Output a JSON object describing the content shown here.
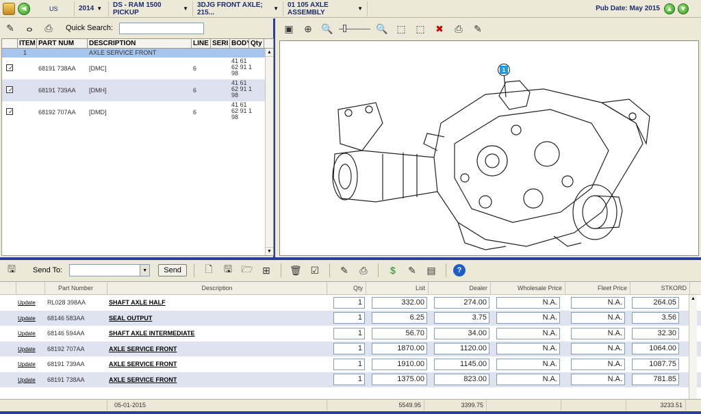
{
  "topbar": {
    "region": "US",
    "year": "2014",
    "model": "DS - RAM 1500 PICKUP",
    "category": "3DJG FRONT AXLE; 215...",
    "assembly": "01 105 AXLE ASSEMBLY",
    "pub_date": "Pub Date: May 2015"
  },
  "parts_list": {
    "quick_search_label": "Quick Search:",
    "quick_search_value": "",
    "headers": [
      "ITEM",
      "PART NUM",
      "DESCRIPTION",
      "LINE",
      "SERI",
      "BODY",
      "Qty"
    ],
    "group_row": {
      "item": "1",
      "description": "AXLE SERVICE FRONT"
    },
    "rows": [
      {
        "part": "68191 738AA",
        "desc": "[DMC]",
        "line": "6",
        "body1": "41 61",
        "body2": "62 91 1",
        "body3": "98"
      },
      {
        "part": "68191 739AA",
        "desc": "[DMH]",
        "line": "6",
        "body1": "41 61",
        "body2": "62 91 1",
        "body3": "98"
      },
      {
        "part": "68192 707AA",
        "desc": "[DMD]",
        "line": "6",
        "body1": "41 61",
        "body2": "62 91 1",
        "body3": "98"
      }
    ]
  },
  "diagram": {
    "callout": "1"
  },
  "order": {
    "send_to_label": "Send To:",
    "send_to_value": "",
    "send_label": "Send",
    "headers": {
      "part_number": "Part Number",
      "description": "Description",
      "qty": "Qty",
      "list": "List",
      "dealer": "Dealer",
      "wholesale": "Wholesale Price",
      "fleet": "Fleet Price",
      "stkord": "STKORD"
    },
    "rows": [
      {
        "action": "Update",
        "part": "RL028 398AA",
        "desc": "SHAFT AXLE HALF",
        "qty": "1",
        "list": "332.00",
        "dealer": "274.00",
        "wholesale": "N.A.",
        "fleet": "N.A.",
        "stkord": "264.05"
      },
      {
        "action": "Update",
        "part": "68146 583AA",
        "desc": "SEAL OUTPUT",
        "qty": "1",
        "list": "6.25",
        "dealer": "3.75",
        "wholesale": "N.A.",
        "fleet": "N.A.",
        "stkord": "3.56"
      },
      {
        "action": "Update",
        "part": "68146 594AA",
        "desc": "SHAFT AXLE INTERMEDIATE",
        "qty": "1",
        "list": "56.70",
        "dealer": "34.00",
        "wholesale": "N.A.",
        "fleet": "N.A.",
        "stkord": "32.30"
      },
      {
        "action": "Update",
        "part": "68192 707AA",
        "desc": "AXLE SERVICE FRONT",
        "qty": "1",
        "list": "1870.00",
        "dealer": "1120.00",
        "wholesale": "N.A.",
        "fleet": "N.A.",
        "stkord": "1064.00"
      },
      {
        "action": "Update",
        "part": "68191 739AA",
        "desc": "AXLE SERVICE FRONT",
        "qty": "1",
        "list": "1910.00",
        "dealer": "1145.00",
        "wholesale": "N.A.",
        "fleet": "N.A.",
        "stkord": "1087.75"
      },
      {
        "action": "Update",
        "part": "68191 738AA",
        "desc": "AXLE SERVICE FRONT",
        "qty": "1",
        "list": "1375.00",
        "dealer": "823.00",
        "wholesale": "N.A.",
        "fleet": "N.A.",
        "stkord": "781.85"
      }
    ],
    "totals": {
      "date": "05-01-2015",
      "list": "5549.95",
      "dealer": "3399.75",
      "stkord": "3233.51"
    }
  }
}
